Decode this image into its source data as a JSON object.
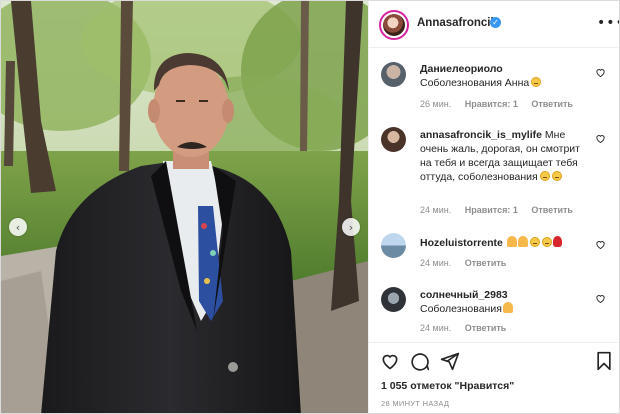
{
  "photo": {
    "alt_icon": "person-photo",
    "prev_arrow": "‹",
    "next_arrow": "›"
  },
  "header": {
    "username": "Annasafroncik",
    "verified_icon": "✓",
    "more_icon": "•••"
  },
  "comments": [
    {
      "username": "Даниелеориоло",
      "text": "Соболезнования Анна",
      "emoji": [
        "sad-face"
      ],
      "time": "26 мин.",
      "likes": "Нравится: 1",
      "reply": "Ответить"
    },
    {
      "username": "annasafroncik_is_mylife",
      "text": "Мне очень жаль, дорогая, он смотрит на тебя и всегда защищает тебя оттуда, соболезнования",
      "emoji": [
        "sad-face",
        "sad-face"
      ],
      "time": "24 мин.",
      "likes": "Нравится: 1",
      "reply": "Ответить"
    },
    {
      "username": "Hozeluistorrente",
      "text": "",
      "emoji": [
        "pray",
        "pray",
        "sad-face",
        "sad-face",
        "rose"
      ],
      "time": "24 мин.",
      "likes": "",
      "reply": "Ответить"
    },
    {
      "username": "солнечный_2983",
      "text": "Соболезнования",
      "emoji": [
        "pray"
      ],
      "time": "24 мин.",
      "likes": "",
      "reply": "Ответить"
    }
  ],
  "actions": {
    "like_icon": "heart-icon",
    "comment_icon": "comment-icon",
    "share_icon": "share-icon",
    "save_icon": "bookmark-icon",
    "likes_count": "1 055 отметок \"Нравится\"",
    "posted_ago": "28 МИНУТ НАЗАД"
  },
  "colors": {
    "verified": "#3897f0",
    "text": "#262626",
    "muted": "#8e8e8e",
    "border": "#efefef"
  }
}
